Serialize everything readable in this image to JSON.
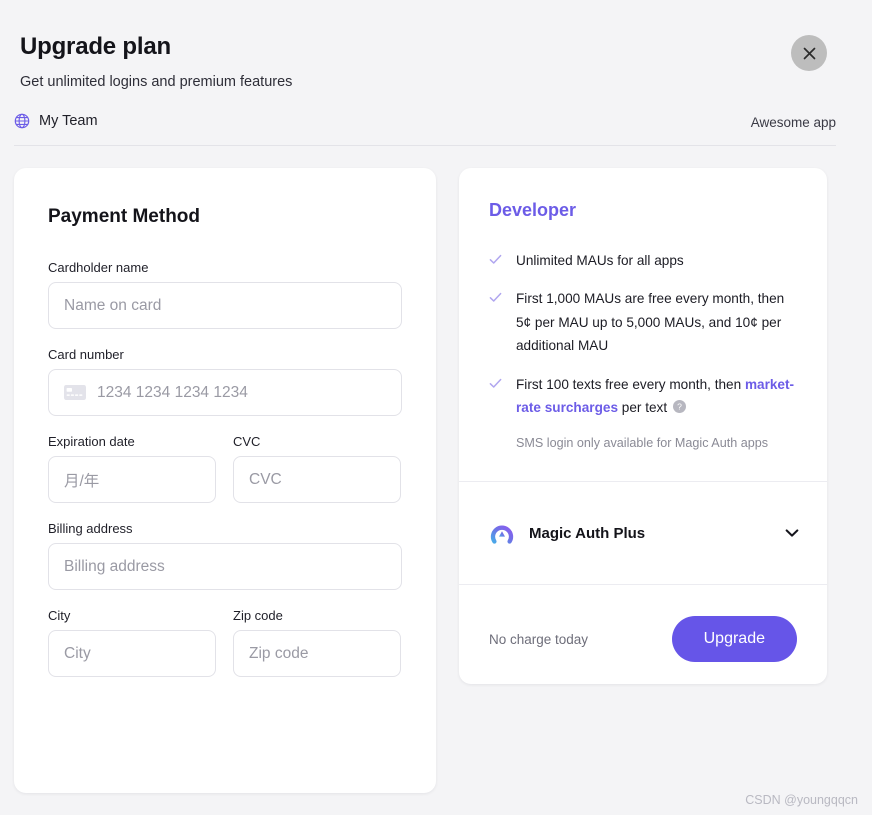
{
  "header": {
    "title": "Upgrade plan",
    "subtitle": "Get unlimited logins and premium features",
    "close_icon": "close-icon",
    "team": {
      "icon": "globe-icon",
      "name": "My Team"
    },
    "app_name": "Awesome app"
  },
  "payment": {
    "title": "Payment Method",
    "fields": {
      "cardholder": {
        "label": "Cardholder name",
        "value": "",
        "placeholder": "Name on card"
      },
      "card_number": {
        "label": "Card number",
        "value": "",
        "placeholder": "1234 1234 1234 1234",
        "icon": "credit-card-icon"
      },
      "expiration": {
        "label": "Expiration date",
        "value": "",
        "placeholder": "月/年"
      },
      "cvc": {
        "label": "CVC",
        "value": "",
        "placeholder": "CVC"
      },
      "billing_address": {
        "label": "Billing address",
        "value": "",
        "placeholder": "Billing address"
      },
      "city": {
        "label": "City",
        "value": "",
        "placeholder": "City"
      },
      "zip": {
        "label": "Zip code",
        "value": "",
        "placeholder": "Zip code"
      }
    }
  },
  "plan": {
    "name": "Developer",
    "features": [
      {
        "text": "Unlimited MAUs for all apps"
      },
      {
        "text": "First 1,000 MAUs are free every month, then 5¢ per MAU up to 5,000 MAUs, and 10¢ per additional MAU"
      }
    ],
    "sms_feature": {
      "prefix": "First 100 texts free every month, then ",
      "link": "market-rate surcharges",
      "suffix": " per text",
      "help_icon": "help-icon",
      "note": "SMS login only available for Magic Auth apps"
    },
    "addon": {
      "name": "Magic Auth Plus",
      "logo": "magic-auth-logo-icon",
      "expand_icon": "chevron-down-icon"
    },
    "footer": {
      "charge_note": "No charge today",
      "upgrade_label": "Upgrade"
    }
  },
  "watermark": "CSDN @youngqqcn",
  "colors": {
    "accent": "#6c5ce7",
    "button": "#6655e8",
    "page_bg": "#f4f4f6",
    "card_bg": "#ffffff"
  }
}
